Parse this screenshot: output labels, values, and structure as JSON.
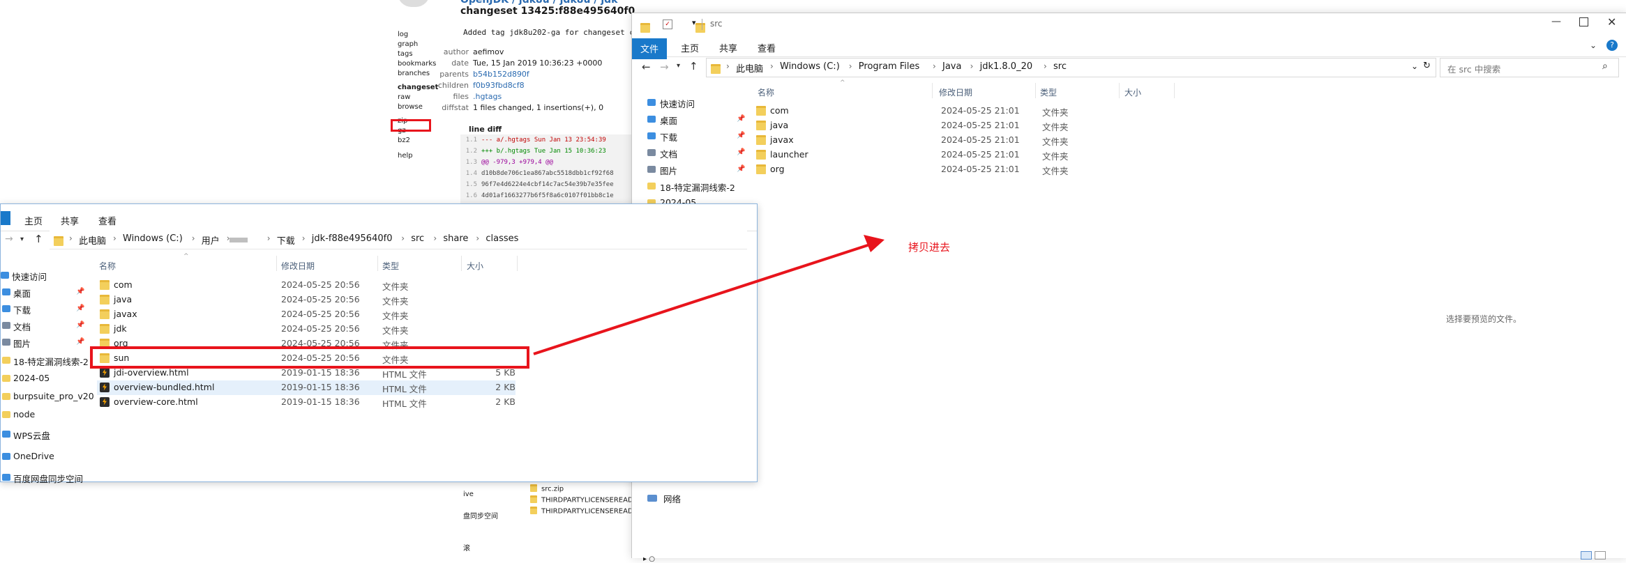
{
  "web": {
    "breadcrumb": "OpenJDK / jdk8u / jdk8u / jdk",
    "changeset_title": "changeset 13425:f88e495640f0",
    "sidebar": [
      "log",
      "graph",
      "tags",
      "bookmarks",
      "branches"
    ],
    "sidebar2": [
      "changeset",
      "raw",
      "browse"
    ],
    "sidebar3": [
      "zip",
      "gz",
      "bz2"
    ],
    "help": "help",
    "description": "Added tag jdk8u202-ga for changeset c",
    "meta": [
      {
        "k": "author",
        "v": "aefimov",
        "link": false
      },
      {
        "k": "date",
        "v": "Tue, 15 Jan 2019 10:36:23 +0000",
        "link": false
      },
      {
        "k": "parents",
        "v": "b54b152d890f",
        "link": true
      },
      {
        "k": "children",
        "v": "f0b93fbd8cf8",
        "link": true
      },
      {
        "k": "files",
        "v": ".hgtags",
        "link": true
      },
      {
        "k": "diffstat",
        "v": "1 files changed, 1 insertions(+), 0",
        "link": false
      }
    ],
    "line_diff": "line diff",
    "diff": [
      {
        "n": "1.1",
        "t": "--- a/.hgtags   Sun Jan 13 23:54:39",
        "c": "#c00000"
      },
      {
        "n": "1.2",
        "t": "+++ b/.hgtags   Tue Jan 15 10:36:23",
        "c": "#008800"
      },
      {
        "n": "1.3",
        "t": "@@ -979,3 +979,4 @@",
        "c": "#990099"
      },
      {
        "n": "1.4",
        "t": "d10b8de706c1ea867abc5518dbb1cf92f68",
        "c": "#444444"
      },
      {
        "n": "1.5",
        "t": "96f7e4d6224e4cbf14c7ac54e39b7e35fee",
        "c": "#444444"
      },
      {
        "n": "1.6",
        "t": "4d01af1663277b6f5f8a6c0107f01bb8c1e",
        "c": "#444444"
      }
    ]
  },
  "left_window": {
    "tabs": [
      "主页",
      "共享",
      "查看"
    ],
    "breadcrumbs": [
      "此电脑",
      "Windows (C:)",
      "用户",
      "",
      "下载",
      "jdk-f88e495640f0",
      "src",
      "share",
      "classes"
    ],
    "columns": {
      "name": "名称",
      "date": "修改日期",
      "type": "类型",
      "size": "大小"
    },
    "nav": [
      {
        "label": "快速访问",
        "icon": "star-icon"
      },
      {
        "label": "桌面",
        "icon": "desktop-icon",
        "pin": true
      },
      {
        "label": "下载",
        "icon": "download-icon",
        "pin": true
      },
      {
        "label": "文档",
        "icon": "document-icon",
        "pin": true
      },
      {
        "label": "图片",
        "icon": "picture-icon",
        "pin": true
      },
      {
        "label": "18-特定漏洞线索-2",
        "icon": "folder-icon"
      },
      {
        "label": "2024-05",
        "icon": "folder-icon"
      },
      {
        "label": "burpsuite_pro_v20",
        "icon": "folder-icon"
      },
      {
        "label": "node",
        "icon": "folder-icon"
      },
      {
        "label": "WPS云盘",
        "icon": "cloud-icon"
      },
      {
        "label": "OneDrive",
        "icon": "cloud-icon"
      },
      {
        "label": "百度网盘同步空间",
        "icon": "cloud-icon"
      }
    ],
    "files": [
      {
        "name": "com",
        "date": "2024-05-25 20:56",
        "type": "文件夹",
        "size": "",
        "kind": "folder"
      },
      {
        "name": "java",
        "date": "2024-05-25 20:56",
        "type": "文件夹",
        "size": "",
        "kind": "folder"
      },
      {
        "name": "javax",
        "date": "2024-05-25 20:56",
        "type": "文件夹",
        "size": "",
        "kind": "folder"
      },
      {
        "name": "jdk",
        "date": "2024-05-25 20:56",
        "type": "文件夹",
        "size": "",
        "kind": "folder"
      },
      {
        "name": "org",
        "date": "2024-05-25 20:56",
        "type": "文件夹",
        "size": "",
        "kind": "folder"
      },
      {
        "name": "sun",
        "date": "2024-05-25 20:56",
        "type": "文件夹",
        "size": "",
        "kind": "folder"
      },
      {
        "name": "jdi-overview.html",
        "date": "2019-01-15 18:36",
        "type": "HTML 文件",
        "size": "5 KB",
        "kind": "html"
      },
      {
        "name": "overview-bundled.html",
        "date": "2019-01-15 18:36",
        "type": "HTML 文件",
        "size": "2 KB",
        "kind": "html"
      },
      {
        "name": "overview-core.html",
        "date": "2019-01-15 18:36",
        "type": "HTML 文件",
        "size": "2 KB",
        "kind": "html"
      }
    ]
  },
  "right_window": {
    "title": "src",
    "tabs": {
      "file": "文件",
      "home": "主页",
      "share": "共享",
      "view": "查看"
    },
    "breadcrumbs": [
      "此电脑",
      "Windows (C:)",
      "Program Files",
      "Java",
      "jdk1.8.0_20",
      "src"
    ],
    "search_placeholder": "在 src 中搜索",
    "columns": {
      "name": "名称",
      "date": "修改日期",
      "type": "类型",
      "size": "大小"
    },
    "nav": [
      {
        "label": "快速访问",
        "icon": "star-icon"
      },
      {
        "label": "桌面",
        "icon": "desktop-icon",
        "pin": true
      },
      {
        "label": "下载",
        "icon": "download-icon",
        "pin": true
      },
      {
        "label": "文档",
        "icon": "document-icon",
        "pin": true
      },
      {
        "label": "图片",
        "icon": "picture-icon",
        "pin": true
      },
      {
        "label": "18-特定漏洞线索-2",
        "icon": "folder-icon"
      },
      {
        "label": "2024-05",
        "icon": "folder-icon"
      }
    ],
    "files": [
      {
        "name": "com",
        "date": "2024-05-25 21:01",
        "type": "文件夹"
      },
      {
        "name": "java",
        "date": "2024-05-25 21:01",
        "type": "文件夹"
      },
      {
        "name": "javax",
        "date": "2024-05-25 21:01",
        "type": "文件夹"
      },
      {
        "name": "launcher",
        "date": "2024-05-25 21:01",
        "type": "文件夹"
      },
      {
        "name": "org",
        "date": "2024-05-25 21:01",
        "type": "文件夹"
      }
    ],
    "preview_text": "选择要预览的文件。",
    "network": "网络"
  },
  "behind_window": {
    "files": [
      "src.zip",
      "THIRDPARTYLICENSEREADM",
      "THIRDPARTYLICENSEREADM"
    ],
    "nav": [
      "ive",
      "盘同步空间",
      "滚"
    ]
  },
  "annotation": {
    "text": "拷贝进去",
    "color": "#e8141c"
  },
  "accent_color": "#1979ca"
}
